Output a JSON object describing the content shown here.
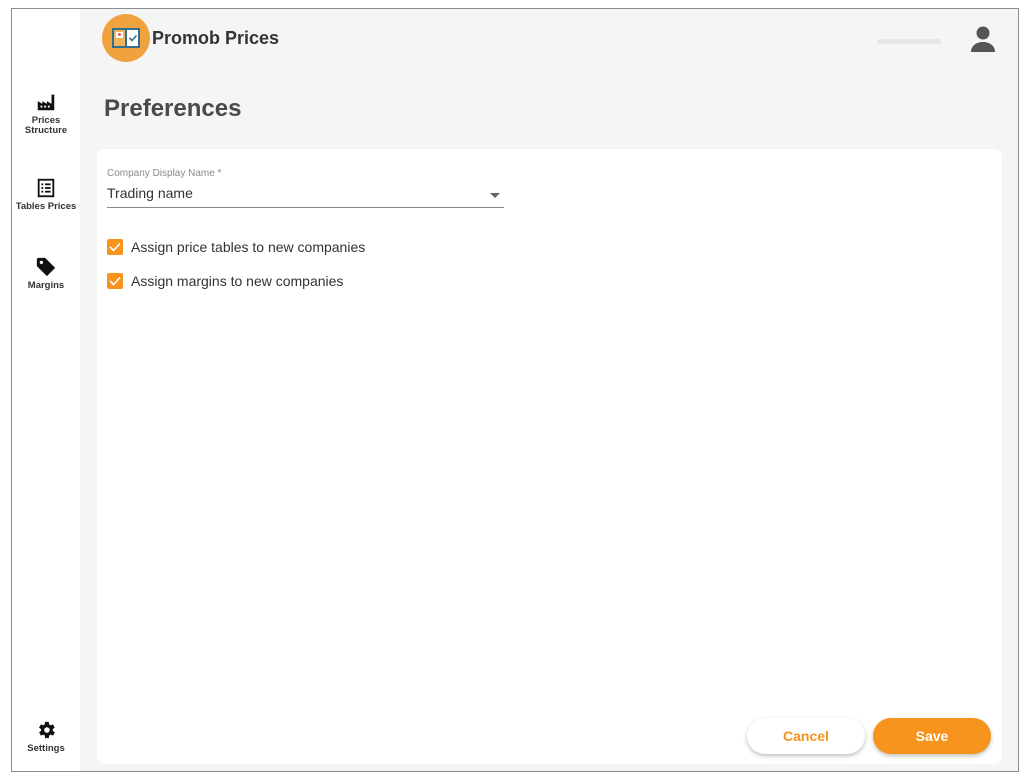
{
  "app": {
    "title": "Promob Prices",
    "logo_icon": "board-logo-icon"
  },
  "sidebar": {
    "items": [
      {
        "label": "Prices Structure",
        "icon": "factory-icon"
      },
      {
        "label": "Tables Prices",
        "icon": "list-icon"
      },
      {
        "label": "Margins",
        "icon": "tag-icon"
      }
    ],
    "settings": {
      "label": "Settings",
      "icon": "gear-icon"
    }
  },
  "page": {
    "title": "Preferences"
  },
  "form": {
    "company_display_name": {
      "label": "Company Display Name *",
      "value": "Trading name"
    },
    "checkboxes": [
      {
        "label": "Assign price tables to new companies",
        "checked": true
      },
      {
        "label": "Assign margins to new companies",
        "checked": true
      }
    ]
  },
  "actions": {
    "cancel_label": "Cancel",
    "save_label": "Save"
  },
  "colors": {
    "accent": "#f7941d",
    "logo_bg": "#f0a23e",
    "background": "#f5f5f5"
  }
}
